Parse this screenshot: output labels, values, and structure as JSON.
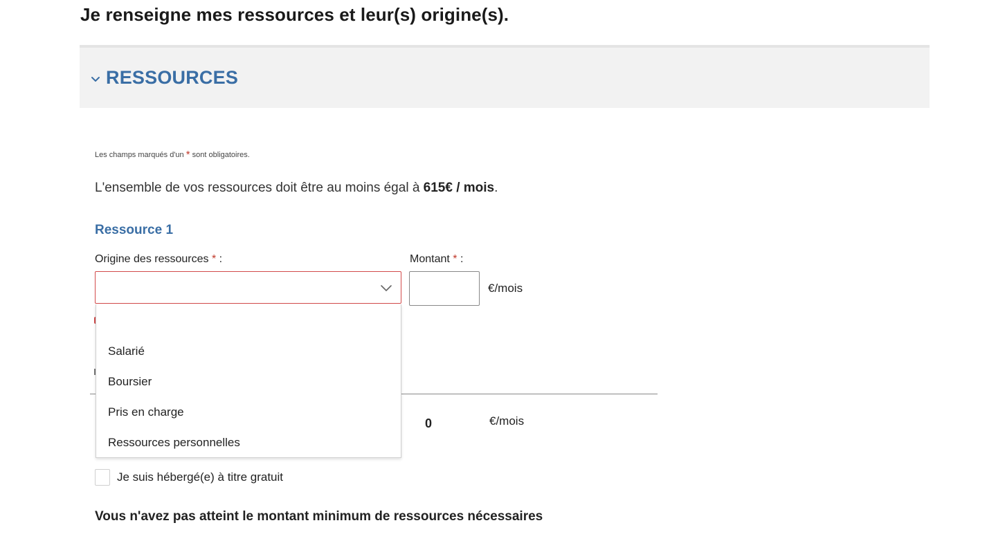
{
  "page": {
    "title": "Je renseigne mes ressources et leur(s) origine(s)."
  },
  "accordion": {
    "title": "RESSOURCES",
    "expanded": true
  },
  "form": {
    "required_note_before": "Les champs marqués d'un ",
    "required_marker": "*",
    "required_note_after": " sont obligatoires.",
    "intro_text": "L'ensemble de vos ressources doit être au moins égal à ",
    "intro_amount": "615€ / mois",
    "intro_suffix": ".",
    "resource_title": "Ressource 1",
    "origin_label": "Origine des ressources ",
    "amount_label": "Montant ",
    "label_suffix": " :",
    "origin_value": "",
    "amount_value": "",
    "unit": "€/mois",
    "origin_options": [
      "",
      "Salarié",
      "Boursier",
      "Pris en charge",
      "Ressources personnelles"
    ],
    "total_value": "0",
    "total_unit": "€/mois",
    "free_housing_label": "Je suis hébergé(e) à titre gratuit",
    "free_housing_checked": false,
    "warning_text": "Vous n'avez pas atteint le montant minimum de ressources nécessaires"
  },
  "colors": {
    "accent": "#3a6ea5",
    "error": "#d24a4a",
    "header_bg": "#f2f2f2"
  },
  "icons": {
    "accordion_toggle": "chevron-down-icon",
    "select_caret": "chevron-down-icon"
  }
}
